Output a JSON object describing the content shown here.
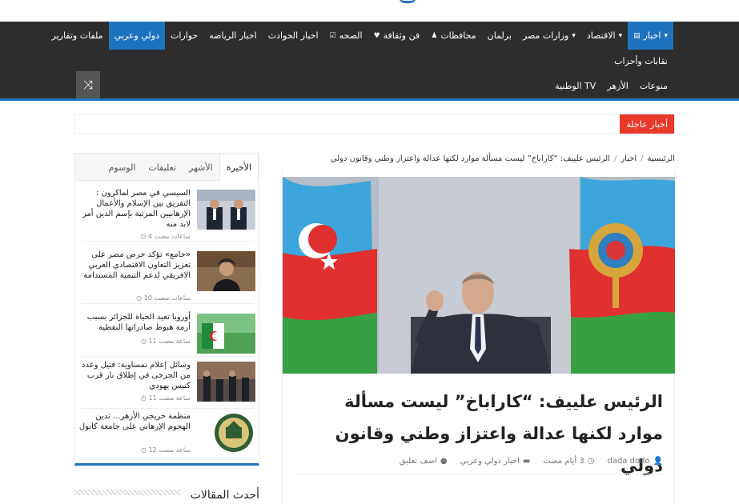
{
  "nav": {
    "row1": [
      {
        "label": "اخبار",
        "icon": "newspaper-icon",
        "caret": true,
        "active": true
      },
      {
        "label": "الاقتصاد",
        "caret": true
      },
      {
        "label": "وزارات مصر",
        "caret": true
      },
      {
        "label": "برلمان"
      },
      {
        "label": "محافظات",
        "icon": "pin-icon"
      },
      {
        "label": "فن وثقافة",
        "icon": "heart-icon"
      },
      {
        "label": "الصحه",
        "icon": "check-square-icon"
      },
      {
        "label": "اخبار الحوادث"
      },
      {
        "label": "اخبار الرياضه"
      },
      {
        "label": "حوارات"
      },
      {
        "label": "دولي وعربي",
        "active": true
      },
      {
        "label": "ملفات وتقارير"
      }
    ],
    "row2": [
      {
        "label": "نقابات وأحزاب"
      }
    ],
    "row3": [
      {
        "label": "منوعات"
      },
      {
        "label": "الأزهر"
      },
      {
        "label": "الوطنية TV"
      }
    ]
  },
  "breaking_label": "أخبار عاجلة",
  "breadcrumb": {
    "home": "الرئيسية",
    "sep": "/",
    "section": "اخبار",
    "current": "الرئيس علييف: “كاراباخ” ليست مسألة موارد لكنها عدالة واعتزاز وطني وقانون دولي"
  },
  "article": {
    "title": "الرئيس علييف: “كاراباخ” ليست مسألة موارد لكنها عدالة واعتزاز وطني وقانون دولي",
    "author": "dada dodo",
    "time": "3 أيام مضت",
    "category": "اخبار دولي وعربي",
    "comment": "اضف تعليق"
  },
  "sidebar": {
    "tabs": [
      "الأخيرة",
      "الأشهر",
      "تعليقات",
      "الوسوم"
    ],
    "posts": [
      {
        "title": "السيسي في مصر لماكرون : التفريق بين الإسلام والأعمال الإرهابيين المرتبة بإسم الدين أمر لابد منه",
        "time": "4 ساعات مضت"
      },
      {
        "title": "«جامع» تؤكد حرص مصر على تعزيز التعاون الاقتصادي العربي الافريقي لدعم التنمية المستدامة",
        "time": "10 ساعات مضت"
      },
      {
        "title": "أوروبا تعيد الحياة للجزائر بسبب أزمة هبوط صادراتها النفطية",
        "time": "11 ساعة مضت"
      },
      {
        "title": "وسائل إعلام نمساوية: قتيل وعدد من الجرحى في إطلاق نار قرب كنيس يهودي",
        "time": "11 ساعة مضت"
      },
      {
        "title": "منظمة خريجي الأزهر... تدين الهجوم الإرهابي على جامعة كابول",
        "time": "12 ساعة مضت"
      }
    ]
  },
  "latest_title": "أحدث المقالات",
  "colors": {
    "accent": "#1e73be",
    "breaking": "#e8392b",
    "nav_bg": "#2d2d2d"
  }
}
